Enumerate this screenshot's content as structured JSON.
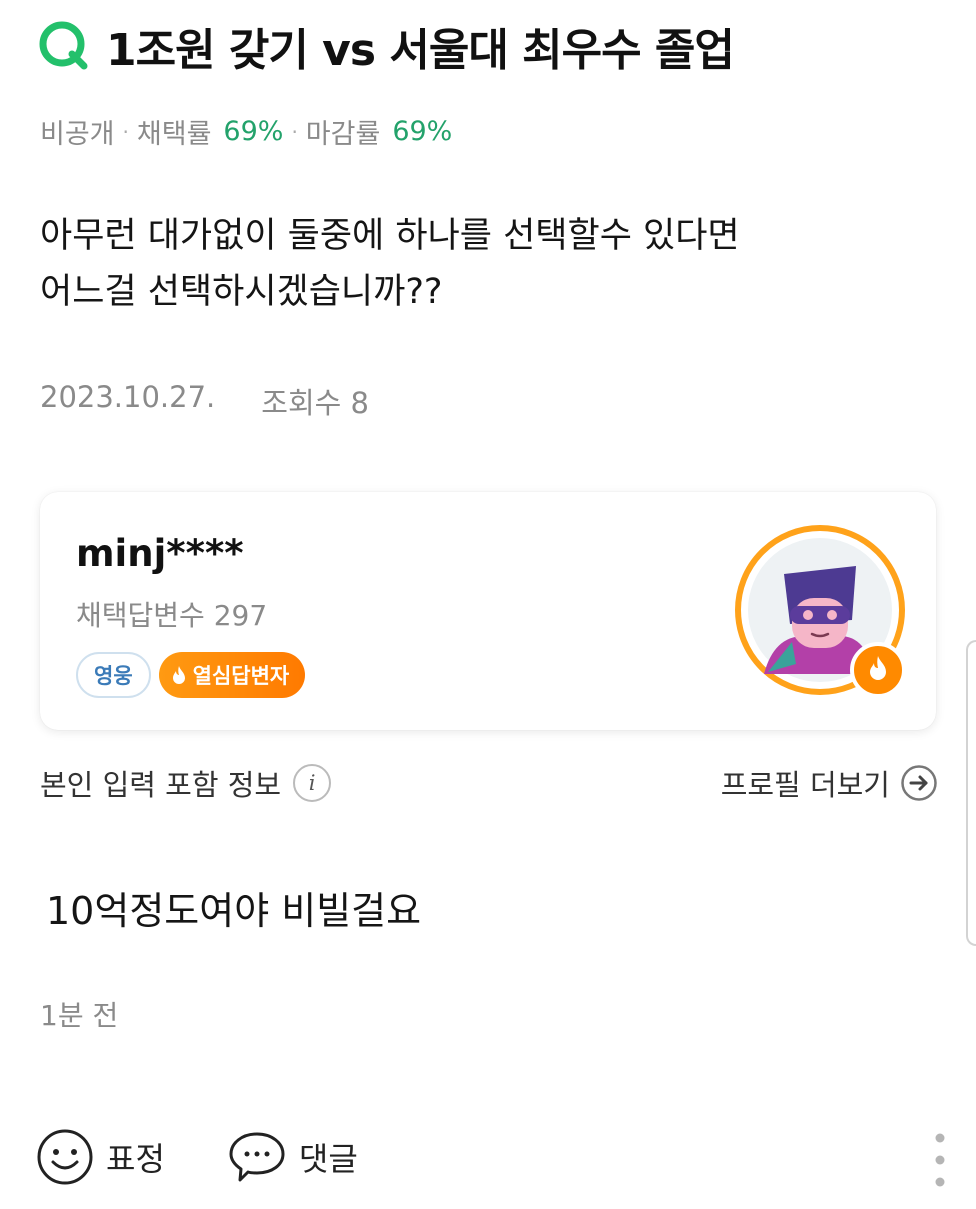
{
  "question": {
    "title": "1조원 갖기 vs 서울대 최우수 졸업",
    "visibility": "비공개",
    "adoption_label": "채택률",
    "adoption_rate": "69%",
    "closing_label": "마감률",
    "closing_rate": "69%",
    "body_line1": "아무런 대가없이 둘중에 하나를 선택할수 있다면",
    "body_line2": "어느걸 선택하시겠습니까??",
    "date": "2023.10.27.",
    "views": "조회수 8"
  },
  "answerer": {
    "username": "minj****",
    "adopted_answers": "채택답변수 297",
    "badge_rank": "영웅",
    "badge_active": "열심답변자"
  },
  "profile_row": {
    "info_label": "본인 입력 포함 정보",
    "more_label": "프로필 더보기"
  },
  "answer": {
    "text": "10억정도여야 비빌걸요",
    "time": "1분 전"
  },
  "footer": {
    "emotion_label": "표정",
    "comment_label": "댓글"
  },
  "colors": {
    "brand_green": "#23a26b",
    "badge_orange": "#ff8a00",
    "badge_blue": "#3b7bb8"
  },
  "icons": [
    "question-q-icon",
    "info-icon",
    "arrow-right-circle-icon",
    "fire-icon",
    "smiley-icon",
    "speech-bubble-icon",
    "more-vertical-icon"
  ]
}
